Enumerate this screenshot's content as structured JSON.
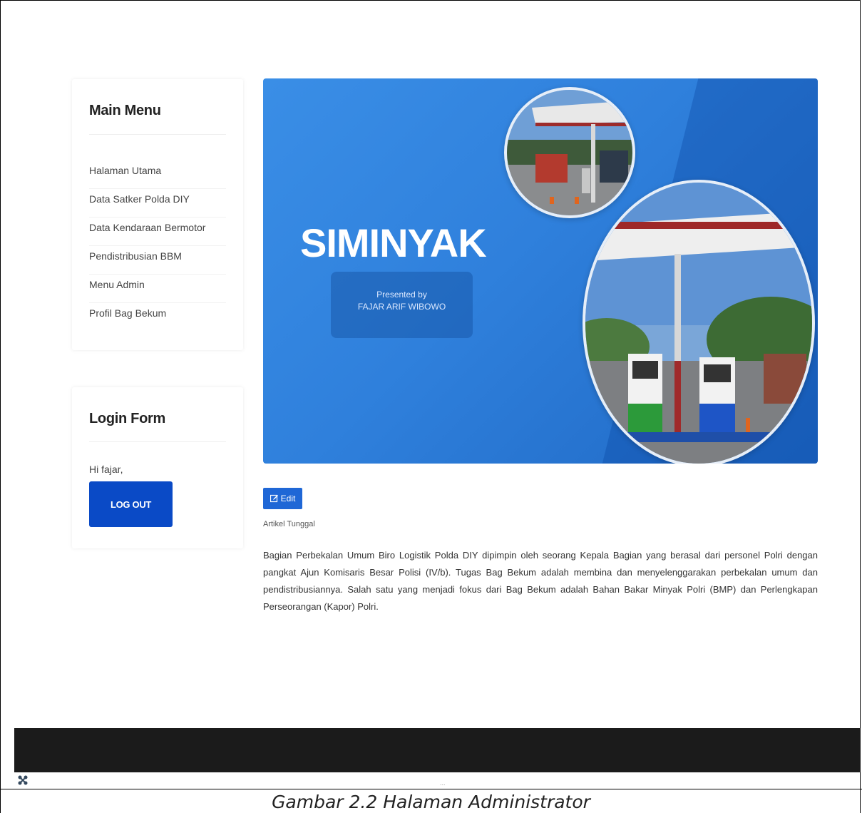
{
  "sidebar": {
    "menu_title": "Main Menu",
    "menu_items": [
      {
        "label": "Halaman Utama"
      },
      {
        "label": "Data Satker Polda DIY"
      },
      {
        "label": "Data Kendaraan Bermotor"
      },
      {
        "label": "Pendistribusian BBM"
      },
      {
        "label": "Menu Admin"
      },
      {
        "label": "Profil Bag Bekum"
      }
    ],
    "login_title": "Login Form",
    "greeting": "Hi fajar,",
    "logout_label": "LOG OUT"
  },
  "banner": {
    "title": "SIMINYAK",
    "presented_line1": "Presented by",
    "presented_line2": "FAJAR ARIF WIBOWO"
  },
  "article": {
    "edit_label": "Edit",
    "tag": "Artikel Tunggal",
    "body": "Bagian Perbekalan Umum Biro Logistik Polda DIY dipimpin oleh seorang Kepala Bagian yang berasal dari personel Polri dengan pangkat Ajun Komisaris Besar Polisi (IV/b). Tugas Bag Bekum adalah membina dan menyelenggarakan perbekalan umum dan pendistribusiannya. Salah satu yang menjadi fokus dari Bag Bekum adalah Bahan Bakar Minyak Polri (BMP) dan Perlengkapan Perseorangan (Kapor) Polri."
  },
  "footer": {
    "dots": "..."
  },
  "caption": "Gambar 2.2 Halaman Administrator",
  "colors": {
    "primary_button": "#0a4ac6",
    "edit_button": "#1f67d6",
    "banner_blue": "#2f80dc",
    "footer_dark": "#1b1b1b"
  },
  "icons": {
    "edit": "edit-icon",
    "joomla": "joomla-icon"
  }
}
